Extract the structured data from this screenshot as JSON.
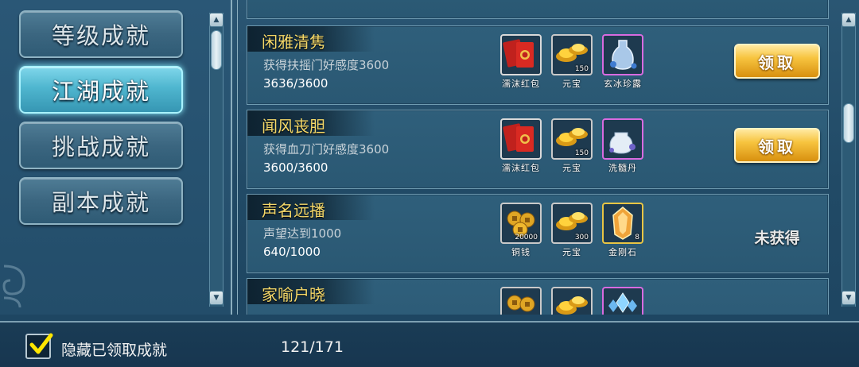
{
  "categories": [
    {
      "label": "等级成就",
      "active": false
    },
    {
      "label": "江湖成就",
      "active": true
    },
    {
      "label": "挑战成就",
      "active": false
    },
    {
      "label": "副本成就",
      "active": false
    }
  ],
  "achievements": [
    {
      "title": "闲雅清隽",
      "description": "获得扶摇门好感度3600",
      "progress": "3636/3600",
      "rewards": [
        {
          "name": "濡沫红包",
          "count": "",
          "icon": "red-envelope-icon"
        },
        {
          "name": "元宝",
          "count": "150",
          "icon": "gold-ingot-icon"
        },
        {
          "name": "玄冰珍露",
          "count": "",
          "icon": "ice-bottle-icon"
        }
      ],
      "action": "领取",
      "status": "claimable"
    },
    {
      "title": "闻风丧胆",
      "description": "获得血刀门好感度3600",
      "progress": "3600/3600",
      "rewards": [
        {
          "name": "濡沫红包",
          "count": "",
          "icon": "red-envelope-icon"
        },
        {
          "name": "元宝",
          "count": "150",
          "icon": "gold-ingot-icon"
        },
        {
          "name": "洗髓丹",
          "count": "",
          "icon": "pill-jar-icon"
        }
      ],
      "action": "领取",
      "status": "claimable"
    },
    {
      "title": "声名远播",
      "description": "声望达到1000",
      "progress": "640/1000",
      "rewards": [
        {
          "name": "铜钱",
          "count": "20000",
          "icon": "copper-coins-icon"
        },
        {
          "name": "元宝",
          "count": "300",
          "icon": "gold-ingot-icon"
        },
        {
          "name": "金刚石",
          "count": "8",
          "icon": "diamond-stone-icon"
        }
      ],
      "action": "未获得",
      "status": "not-obtained"
    },
    {
      "title": "家喻户晓",
      "description": "",
      "progress": "",
      "rewards": [
        {
          "name": "",
          "count": "",
          "icon": "copper-coins-icon"
        },
        {
          "name": "",
          "count": "",
          "icon": "gold-ingot-icon"
        },
        {
          "name": "",
          "count": "",
          "icon": "crystal-icon"
        }
      ],
      "action": "",
      "status": "not-obtained"
    }
  ],
  "footer": {
    "hide_claimed_label": "隐藏已领取成就",
    "hide_claimed_checked": true,
    "total_count": "121/171"
  },
  "colors": {
    "title_gold": "#f5d96a",
    "claim_button": "#f7c43f",
    "active_tab": "#4fb6cf"
  }
}
